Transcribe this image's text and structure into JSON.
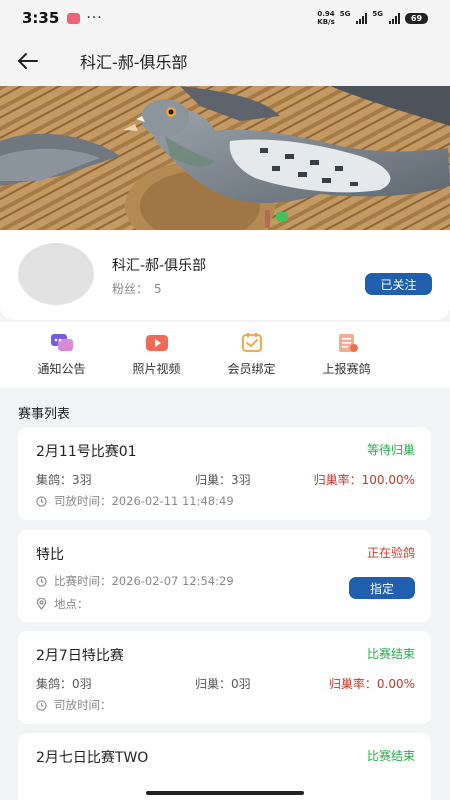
{
  "status_bar": {
    "time": "3:35",
    "dots": "···",
    "net_speed_value": "0.94",
    "net_speed_unit": "KB/s",
    "signal1": "5G",
    "signal2": "5G",
    "battery": "69"
  },
  "header": {
    "title": "科汇-郝-俱乐部"
  },
  "profile": {
    "name": "科汇-郝-俱乐部",
    "fans_label": "粉丝：",
    "fans_count": "5",
    "follow_label": "已关注"
  },
  "menu": {
    "items": [
      {
        "label": "通知公告",
        "icon": "notice-icon"
      },
      {
        "label": "照片视频",
        "icon": "video-icon"
      },
      {
        "label": "会员绑定",
        "icon": "member-bind-icon"
      },
      {
        "label": "上报赛鸽",
        "icon": "report-icon"
      }
    ]
  },
  "section": {
    "title": "赛事列表"
  },
  "races": [
    {
      "name": "2月11号比赛01",
      "status": "等待归巢",
      "status_color": "#2aa84a",
      "collect": "集鸽：3羽",
      "home": "归巢：3羽",
      "rate": "归巢率：100.00%",
      "time": "司放时间：2026-02-11 11:48:49"
    },
    {
      "name": "特比",
      "status": "正在验鸽",
      "status_color": "#c0392b",
      "time": "比赛时间：2026-02-07 12:54:29",
      "location": "地点：",
      "assign_label": "指定"
    },
    {
      "name": "2月7日特比赛",
      "status": "比赛结束",
      "status_color": "#2aa84a",
      "collect": "集鸽：0羽",
      "home": "归巢：0羽",
      "rate": "归巢率：0.00%",
      "time": "司放时间："
    },
    {
      "name": "2月七日比赛TWO",
      "status": "比赛结束",
      "status_color": "#2aa84a"
    }
  ]
}
